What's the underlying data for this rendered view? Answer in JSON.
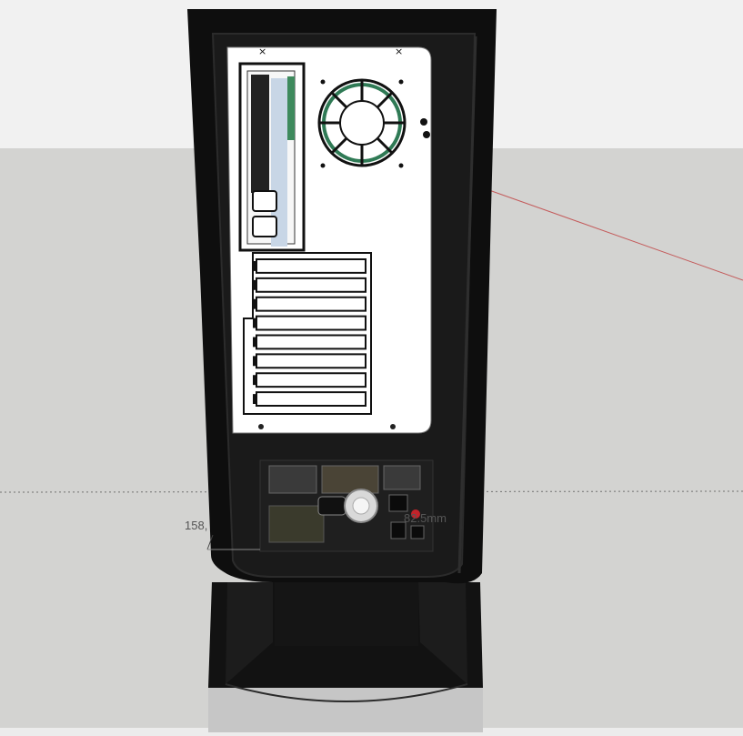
{
  "scene": {
    "sky_color": "#f1f1f1",
    "ground_color": "#d3d3d1",
    "axis_red_color": "#c45b5b",
    "axis_dotted_color": "#707070"
  },
  "model": {
    "case_color": "#0e0e0e",
    "case_edge_color": "#1c1c1c",
    "panel_color": "#ffffff",
    "fan_accent_color": "#2f7a55",
    "psu_color": "#1f1f1f",
    "stand_color": "#161616",
    "base_color": "#c6c6c6",
    "expansion_slot_count": 8
  },
  "dimensions": {
    "left_label": "158,",
    "right_label": "82.5mm"
  }
}
